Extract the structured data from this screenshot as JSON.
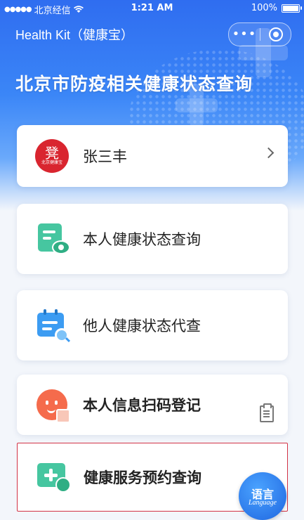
{
  "status_bar": {
    "signal": "●●●●●",
    "carrier": "北京经信",
    "wifi_icon": "wifi-icon",
    "time": "1:21 AM",
    "battery": "100%"
  },
  "nav": {
    "title": "Health Kit（健康宝）",
    "more_icon": "•••",
    "close_icon": "target-icon"
  },
  "headline": "北京市防疫相关健康状态查询",
  "user_card": {
    "badge_glyph": "凳",
    "badge_caption": "北京健康宝",
    "name": "张三丰"
  },
  "menu": [
    {
      "label": "本人健康状态查询",
      "icon": "doc-eye-icon"
    },
    {
      "label": "他人健康状态代查",
      "icon": "calendar-search-icon"
    },
    {
      "label": "本人信息扫码登记",
      "icon": "face-qr-icon"
    },
    {
      "label": "健康服务预约查询",
      "icon": "medical-plus-icon"
    }
  ],
  "language_button": {
    "zh": "语言",
    "en": "Language"
  },
  "colors": {
    "accent_blue": "#2f6df0",
    "green": "#46c6a0",
    "badge_red": "#d9252f",
    "highlight_border": "#d23245"
  }
}
